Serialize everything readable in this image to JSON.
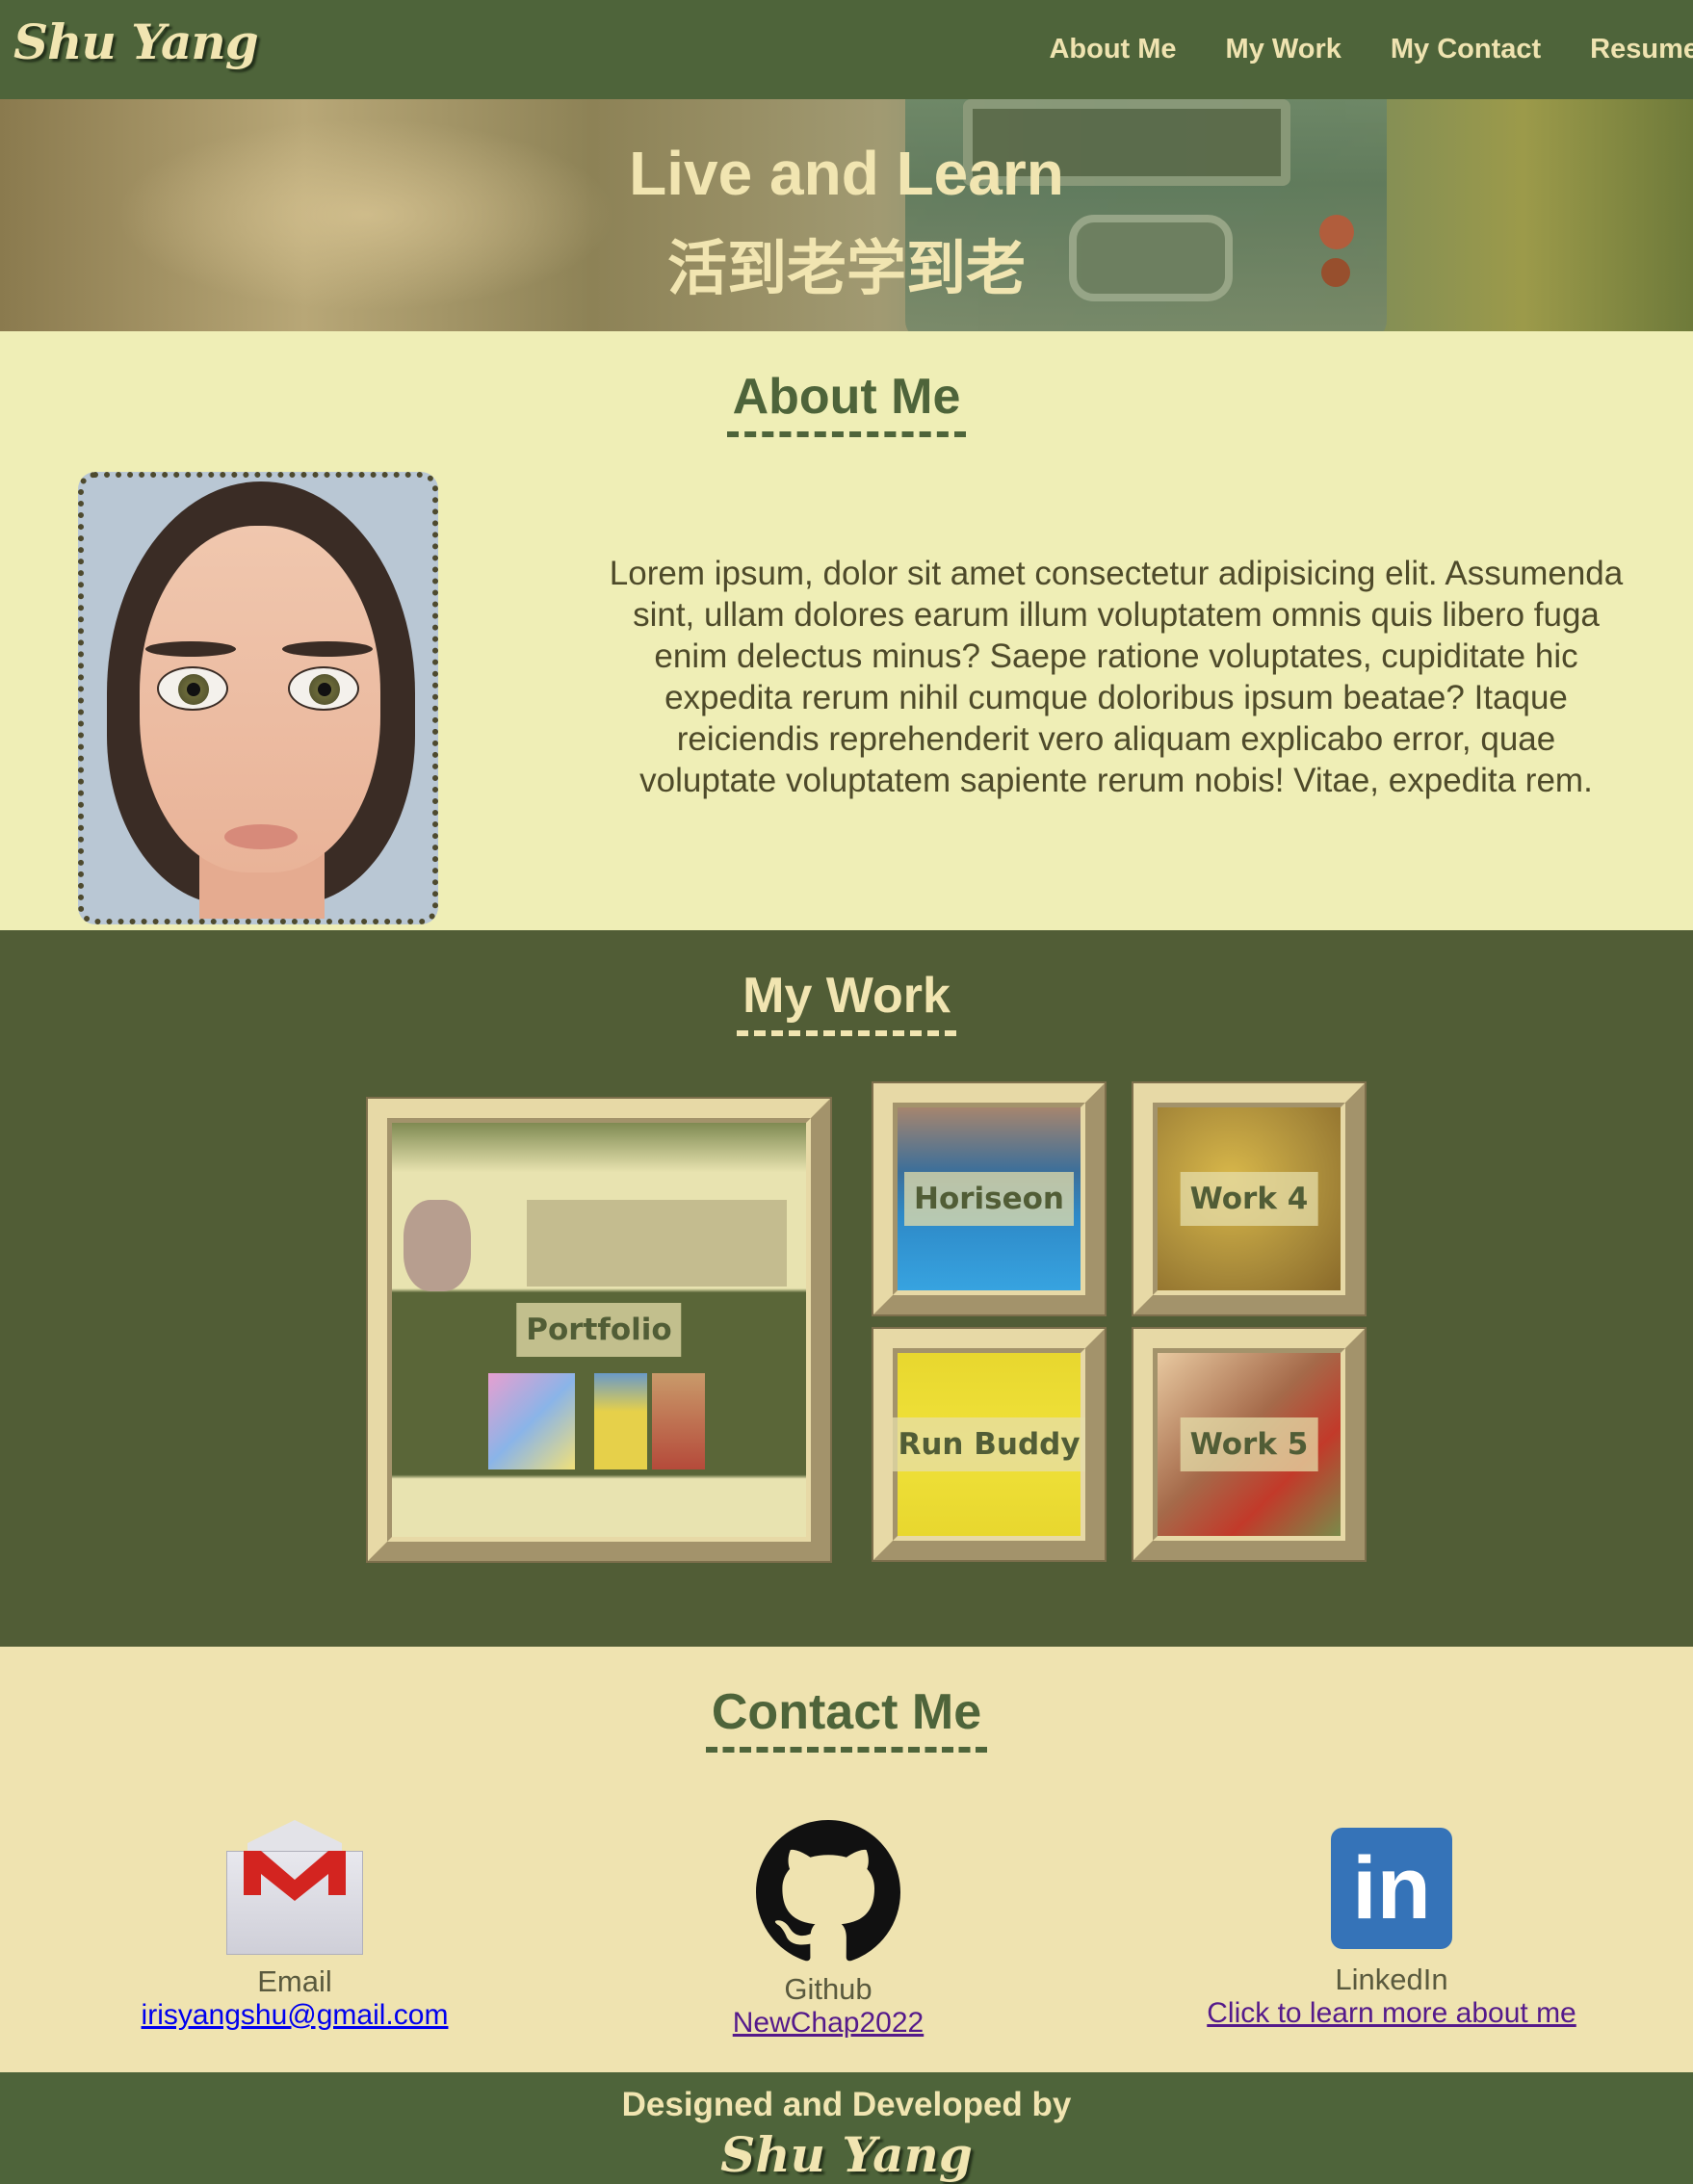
{
  "header": {
    "logo": "Shu Yang",
    "nav": [
      "About Me",
      "My Work",
      "My Contact",
      "Resume"
    ]
  },
  "hero": {
    "title_en": "Live and Learn",
    "title_zh": "活到老学到老"
  },
  "about": {
    "title": "About Me",
    "text": "Lorem ipsum, dolor sit amet consectetur adipisicing elit. Assumenda sint, ullam dolores earum illum voluptatem omnis quis libero fuga enim delectus minus? Saepe ratione voluptates, cupiditate hic expedita rerum nihil cumque doloribus ipsum beatae? Itaque reiciendis reprehenderit vero aliquam explicabo error, quae voluptate voluptatem sapiente rerum nobis! Vitae, expedita rem."
  },
  "work": {
    "title": "My Work",
    "items": [
      "Portfolio",
      "Horiseon",
      "Work 4",
      "Run Buddy",
      "Work 5"
    ]
  },
  "contact": {
    "title": "Contact Me",
    "email": {
      "label": "Email",
      "link": "irisyangshu@gmail.com",
      "icon": "gmail-icon"
    },
    "github": {
      "label": "Github",
      "link": "NewChap2022",
      "icon": "github-icon"
    },
    "linkedin": {
      "label": "LinkedIn",
      "link": "Click to learn more about me",
      "icon": "linkedin-icon",
      "glyph": "in"
    }
  },
  "footer": {
    "by": "Designed and Developed by",
    "name": "Shu Yang"
  },
  "colors": {
    "primary": "#4e643a",
    "work_bg": "#515d36",
    "about_bg": "#efeeb6",
    "contact_bg": "#efe3b0",
    "accent_text": "#f1e5b1"
  }
}
